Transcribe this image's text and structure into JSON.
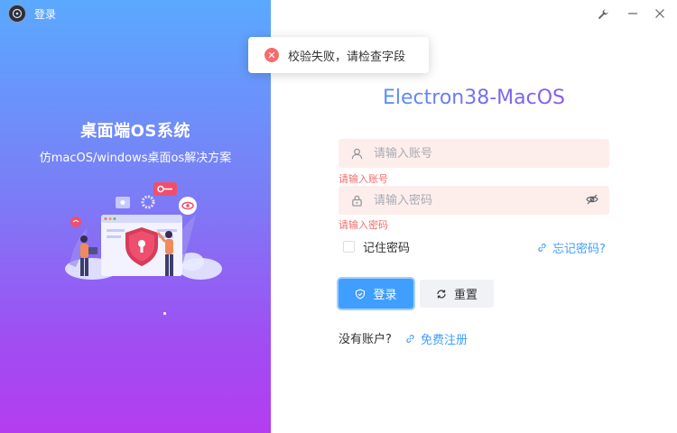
{
  "window": {
    "title": "登录",
    "controls": {
      "pin_icon": "wrench-icon",
      "minimize_icon": "minimize-icon",
      "close_icon": "close-icon"
    }
  },
  "hero": {
    "title": "桌面端OS系统",
    "subtitle": "仿macOS/windows桌面os解决方案"
  },
  "toast": {
    "type": "error",
    "message": "校验失败，请检查字段"
  },
  "brand": {
    "title": "Electron38-MacOS"
  },
  "form": {
    "username": {
      "placeholder": "请输入账号",
      "value": "",
      "error": "请输入账号",
      "icon": "user-icon"
    },
    "password": {
      "placeholder": "请输入密码",
      "value": "",
      "error": "请输入密码",
      "icon": "lock-icon",
      "toggle_icon": "eye-hidden-icon"
    },
    "remember": {
      "label": "记住密码",
      "checked": false
    },
    "forgot": {
      "label": "忘记密码?"
    },
    "login_button": {
      "label": "登录"
    },
    "reset_button": {
      "label": "重置"
    },
    "register": {
      "prompt": "没有账户?",
      "link": "免费注册"
    }
  },
  "colors": {
    "accent": "#409eff",
    "error": "#f56c6c",
    "input_error_bg": "#fdeeec",
    "panel_gradient_top": "#5aa9ff",
    "panel_gradient_bottom": "#b43df0"
  }
}
